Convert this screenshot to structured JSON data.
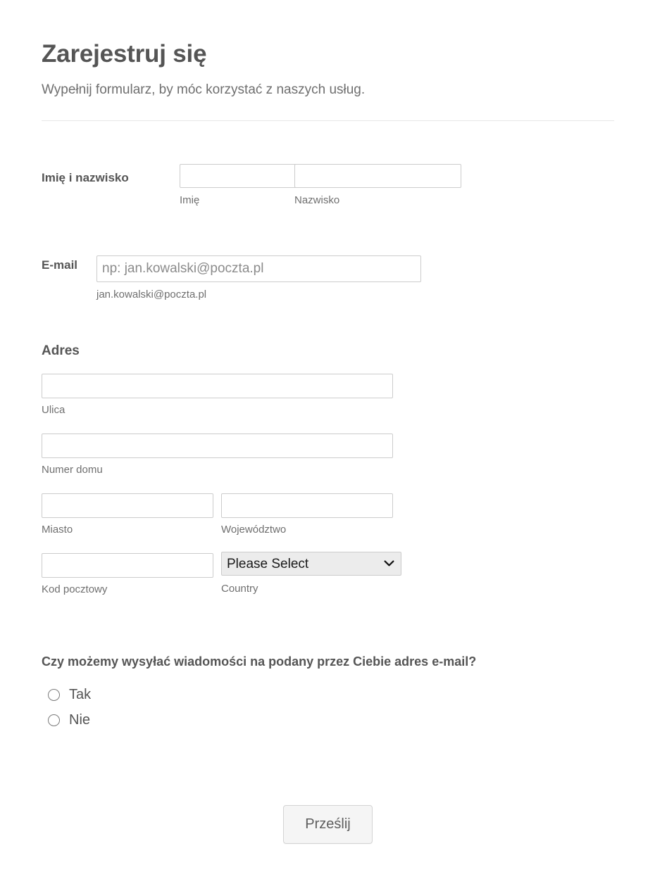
{
  "header": {
    "title": "Zarejestruj się",
    "subtitle": "Wypełnij formularz, by móc korzystać z naszych usług."
  },
  "fields": {
    "fullname": {
      "label": "Imię i nazwisko",
      "first": {
        "sublabel": "Imię",
        "value": "",
        "placeholder": ""
      },
      "last": {
        "sublabel": "Nazwisko",
        "value": "",
        "placeholder": ""
      }
    },
    "email": {
      "label": "E-mail",
      "placeholder": "np: jan.kowalski@poczta.pl",
      "value": "",
      "sublabel": "jan.kowalski@poczta.pl"
    },
    "address": {
      "heading": "Adres",
      "street": {
        "sublabel": "Ulica",
        "value": "",
        "placeholder": ""
      },
      "house": {
        "sublabel": "Numer domu",
        "value": "",
        "placeholder": ""
      },
      "city": {
        "sublabel": "Miasto",
        "value": "",
        "placeholder": ""
      },
      "state": {
        "sublabel": "Województwo",
        "value": "",
        "placeholder": ""
      },
      "zip": {
        "sublabel": "Kod pocztowy",
        "value": "",
        "placeholder": ""
      },
      "country": {
        "sublabel": "Country",
        "selected": "Please Select",
        "options": [
          "Please Select"
        ],
        "icon": "chevron-down-icon"
      }
    },
    "consent": {
      "question": "Czy możemy wysyłać wiadomości na podany przez Ciebie adres e-mail?",
      "options": [
        {
          "label": "Tak",
          "selected": false
        },
        {
          "label": "Nie",
          "selected": false
        }
      ]
    }
  },
  "submit": {
    "label": "Prześlij"
  },
  "colors": {
    "page_background": "#ffffff",
    "heading_text": "#555555",
    "sublabel_text": "#6f6f6f",
    "input_border": "#cccccc",
    "divider": "#e6e6e6",
    "select_background": "#ececec",
    "button_background": "#f5f5f5"
  }
}
